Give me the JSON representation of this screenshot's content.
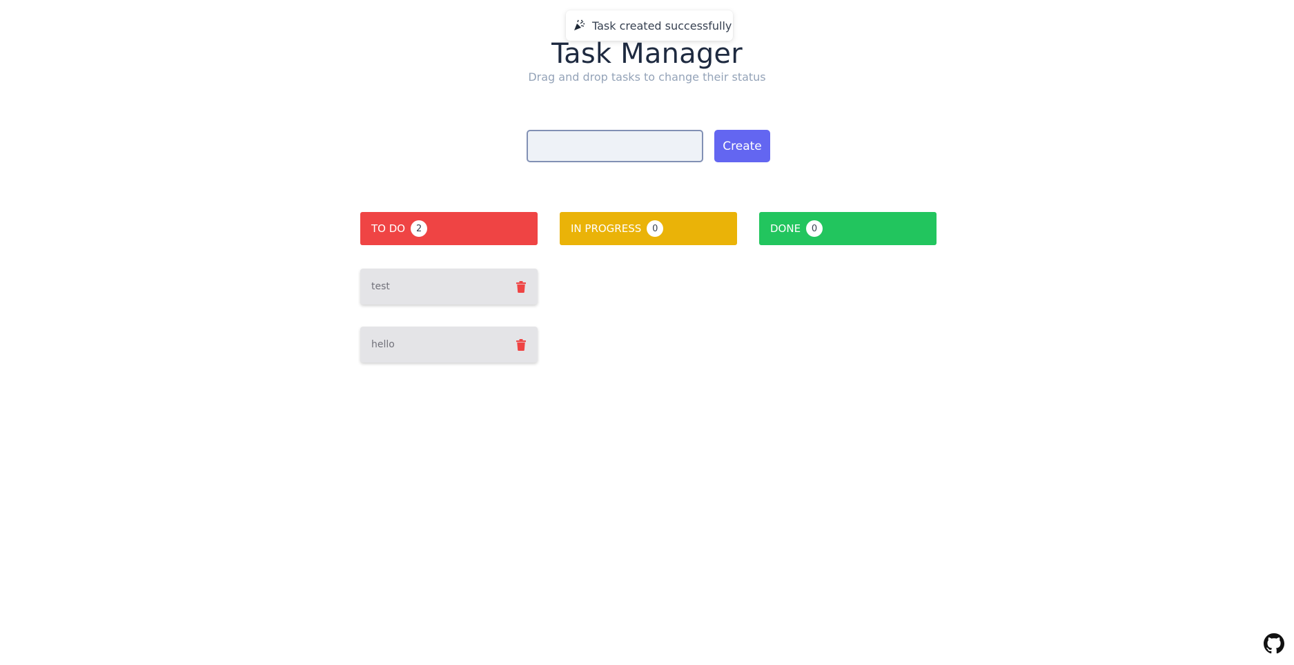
{
  "toast": {
    "icon": "party-popper-icon",
    "message": "Task created successfully"
  },
  "header": {
    "title": "Task Manager",
    "subtitle": "Drag and drop tasks to change their status"
  },
  "form": {
    "input_value": "",
    "input_placeholder": "",
    "create_label": "Create"
  },
  "columns": [
    {
      "label": "TO DO",
      "count": "2",
      "color": "#ef4444"
    },
    {
      "label": "IN PROGRESS",
      "count": "0",
      "color": "#eab308"
    },
    {
      "label": "DONE",
      "count": "0",
      "color": "#22c55e"
    }
  ],
  "tasks": [
    {
      "text": "test",
      "status": "TO DO",
      "icon": "trash-icon"
    },
    {
      "text": "hello",
      "status": "TO DO",
      "icon": "trash-icon"
    }
  ],
  "footer": {
    "icon": "github-icon"
  },
  "colors": {
    "accent": "#6366f1",
    "delete": "#ef4444"
  }
}
